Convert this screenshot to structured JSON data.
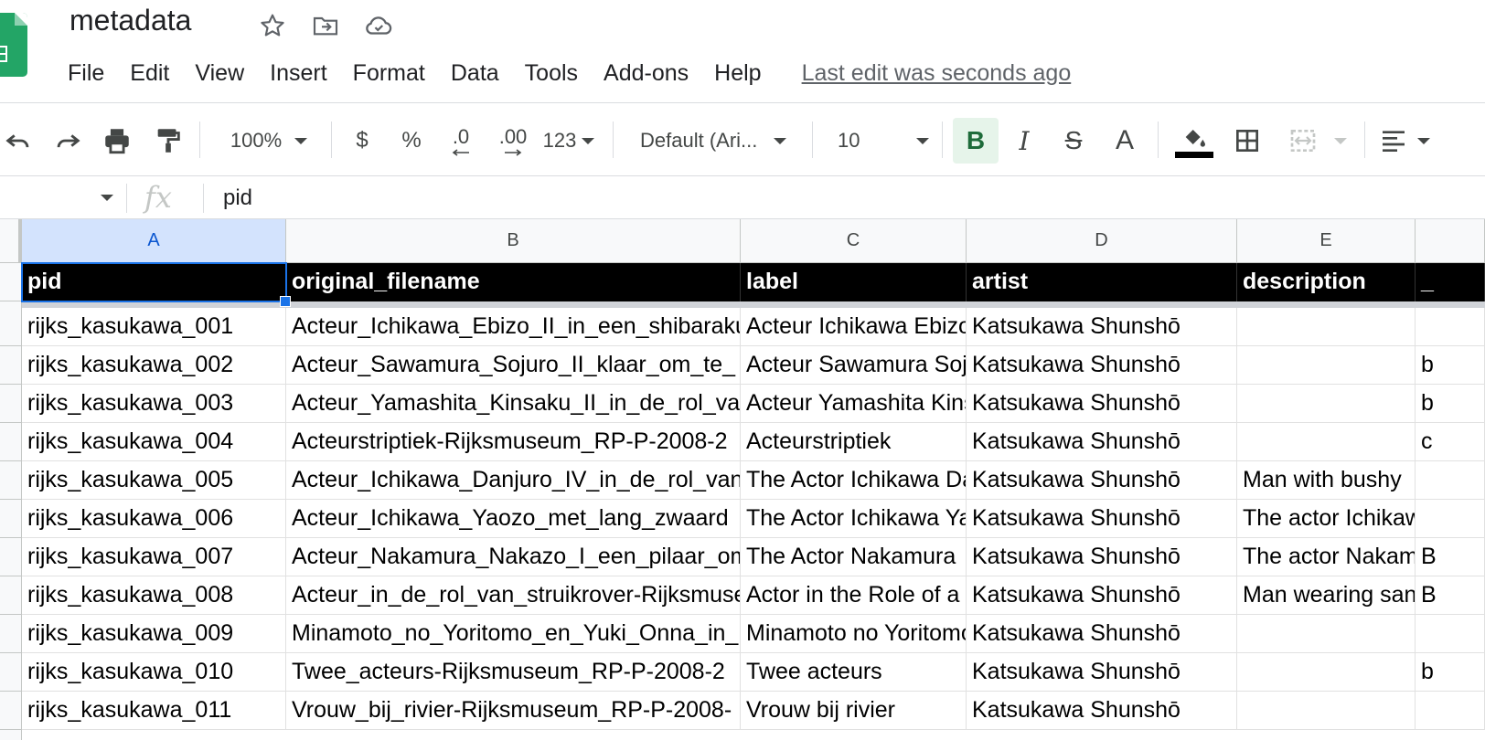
{
  "document": {
    "title": "metadata"
  },
  "menu": {
    "items": [
      "File",
      "Edit",
      "View",
      "Insert",
      "Format",
      "Data",
      "Tools",
      "Add-ons",
      "Help"
    ],
    "last_edit": "Last edit was seconds ago"
  },
  "toolbar": {
    "zoom": "100%",
    "currency": "$",
    "percent": "%",
    "decrease_decimal": ".0",
    "increase_decimal": ".00",
    "more_formats": "123",
    "font_family": "Default (Ari...",
    "font_size": "10",
    "bold": "B",
    "italic": "I",
    "strikethrough": "S",
    "text_color": "A"
  },
  "formula_bar": {
    "fx": "fx",
    "value": "pid"
  },
  "sheet": {
    "columns": [
      "A",
      "B",
      "C",
      "D",
      "E"
    ],
    "header": [
      "pid",
      "original_filename",
      "label",
      "artist",
      "description",
      "_"
    ],
    "rows": [
      [
        "rijks_kasukawa_001",
        "Acteur_Ichikawa_Ebizo_II_in_een_shibaraku",
        "Acteur Ichikawa Ebizo",
        "Katsukawa Shunshō",
        "",
        ""
      ],
      [
        "rijks_kasukawa_002",
        "Acteur_Sawamura_Sojuro_II_klaar_om_te_",
        "Acteur Sawamura Sojuro",
        "Katsukawa Shunshō",
        "",
        "b"
      ],
      [
        "rijks_kasukawa_003",
        "Acteur_Yamashita_Kinsaku_II_in_de_rol_va",
        "Acteur Yamashita Kinsaku",
        "Katsukawa Shunshō",
        "",
        "b"
      ],
      [
        "rijks_kasukawa_004",
        "Acteurstriptiek-Rijksmuseum_RP-P-2008-2",
        "Acteurstriptiek",
        "Katsukawa Shunshō",
        "",
        "c"
      ],
      [
        "rijks_kasukawa_005",
        "Acteur_Ichikawa_Danjuro_IV_in_de_rol_van",
        "The Actor Ichikawa Danjuro",
        "Katsukawa Shunshō",
        "Man with bushy",
        ""
      ],
      [
        "rijks_kasukawa_006",
        "Acteur_Ichikawa_Yaozo_met_lang_zwaard",
        "The Actor Ichikawa Yaozo",
        "Katsukawa Shunshō",
        "The actor Ichikawa",
        ""
      ],
      [
        "rijks_kasukawa_007",
        "Acteur_Nakamura_Nakazo_I_een_pilaar_om",
        "The Actor Nakamura",
        "Katsukawa Shunshō",
        "The actor Nakamura",
        "B"
      ],
      [
        "rijks_kasukawa_008",
        "Acteur_in_de_rol_van_struikrover-Rijksmuseum",
        "Actor in the Role of a",
        "Katsukawa Shunshō",
        "Man wearing sandals",
        "B"
      ],
      [
        "rijks_kasukawa_009",
        "Minamoto_no_Yoritomo_en_Yuki_Onna_in_",
        "Minamoto no Yoritomo",
        "Katsukawa Shunshō",
        "",
        ""
      ],
      [
        "rijks_kasukawa_010",
        "Twee_acteurs-Rijksmuseum_RP-P-2008-2",
        "Twee acteurs",
        "Katsukawa Shunshō",
        "",
        "b"
      ],
      [
        "rijks_kasukawa_011",
        "Vrouw_bij_rivier-Rijksmuseum_RP-P-2008-",
        "Vrouw bij rivier",
        "Katsukawa Shunshō",
        "",
        ""
      ]
    ]
  },
  "colors": {
    "brand_green": "#23a566",
    "selection_blue": "#1a73e8",
    "header_bg": "#000000"
  }
}
